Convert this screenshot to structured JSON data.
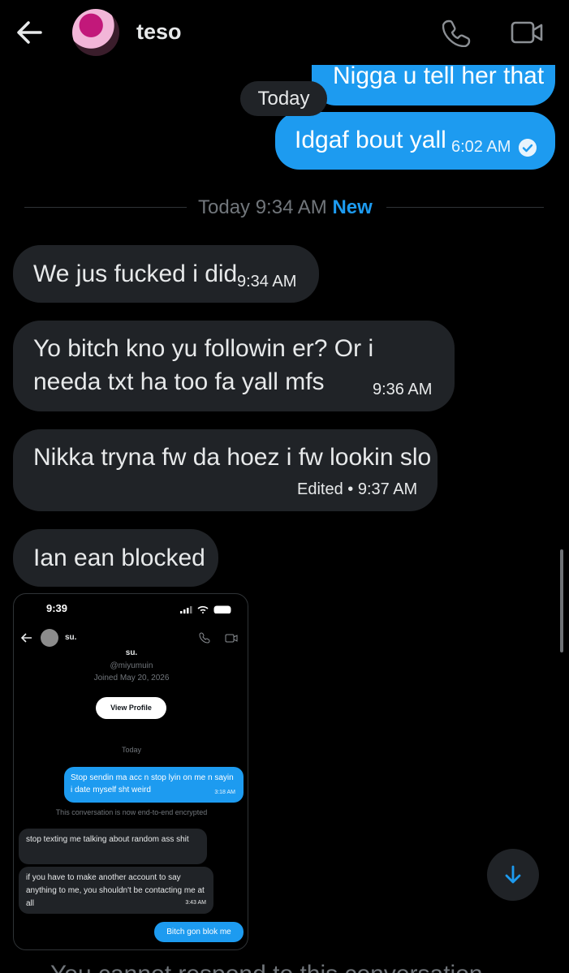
{
  "header": {
    "contact_name": "teso",
    "icons": [
      "back-arrow-icon",
      "phone-icon",
      "video-icon"
    ]
  },
  "messages_before": [
    {
      "text": "Nigga u tell her that"
    },
    {
      "text": "Idgaf bout yall",
      "time": "6:02 AM",
      "status": "read"
    }
  ],
  "today_pill": "Today",
  "divider": {
    "text": "Today 9:34 AM",
    "new_label": "New"
  },
  "incoming": [
    {
      "text": "We jus fucked i did",
      "time": "9:34 AM"
    },
    {
      "text": "Yo bitch kno yu followin er? Or i needa txt ha too fa yall mfs",
      "time": "9:36 AM"
    },
    {
      "text": "Nikka tryna fw da hoez i fw lookin slo",
      "time": "Edited • 9:37 AM"
    },
    {
      "text": "Ian ean blocked"
    }
  ],
  "shot": {
    "clock": "9:39",
    "name": "su.",
    "profile_name": "su.",
    "handle": "@miyumuin",
    "joined": "Joined May 20, 2026",
    "view_profile": "View Profile",
    "today": "Today",
    "out1": "Stop sendin ma acc n stop lyin on me n sayin i date myself sht weird",
    "out1_time": "3:18 AM",
    "encrypted_note": "This conversation is now end-to-end encrypted",
    "in1": "stop texting me talking about random ass shit",
    "in2": "if you have to make another account to say anything to me, you shouldn't be contacting me at all",
    "in2_time": "3:43 AM",
    "out2": "Bitch gon blok me"
  },
  "bottom_partial_text": "You cannot respond to this conversation",
  "colors": {
    "accent": "#1d9bf0",
    "bubble_in": "#202327",
    "background": "#000000",
    "muted": "#71767b"
  }
}
